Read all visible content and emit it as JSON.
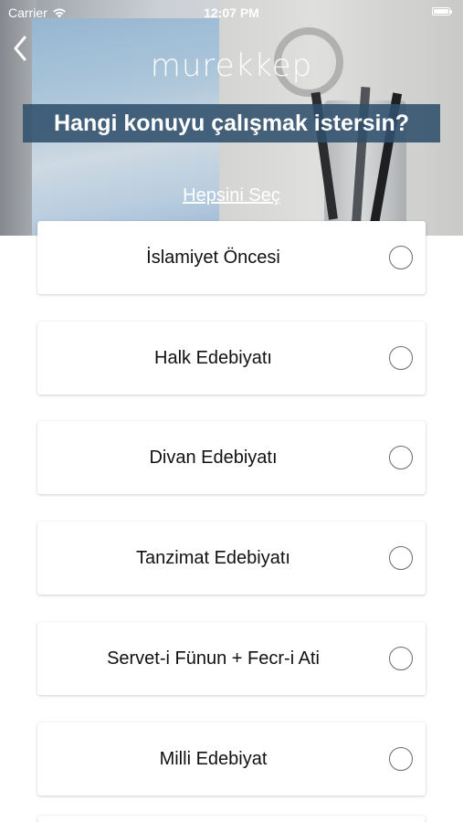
{
  "status_bar": {
    "carrier": "Carrier",
    "time": "12:07 PM",
    "icons": [
      "wifi-icon",
      "battery-icon"
    ]
  },
  "header": {
    "back_icon": "chevron-left-icon",
    "logo_text": "murekkep",
    "title": "Hangi konuyu çalışmak istersin?",
    "select_all": "Hepsini Seç"
  },
  "topics": [
    {
      "label": "İslamiyet Öncesi",
      "selected": false
    },
    {
      "label": "Halk Edebiyatı",
      "selected": false
    },
    {
      "label": "Divan Edebiyatı",
      "selected": false
    },
    {
      "label": "Tanzimat Edebiyatı",
      "selected": false
    },
    {
      "label": "Servet-i Fünun + Fecr-i Ati",
      "selected": false
    },
    {
      "label": "Milli Edebiyat",
      "selected": false
    }
  ],
  "colors": {
    "banner": "#30506c",
    "radio_border": "#6b6b6b",
    "text": "#111111"
  }
}
